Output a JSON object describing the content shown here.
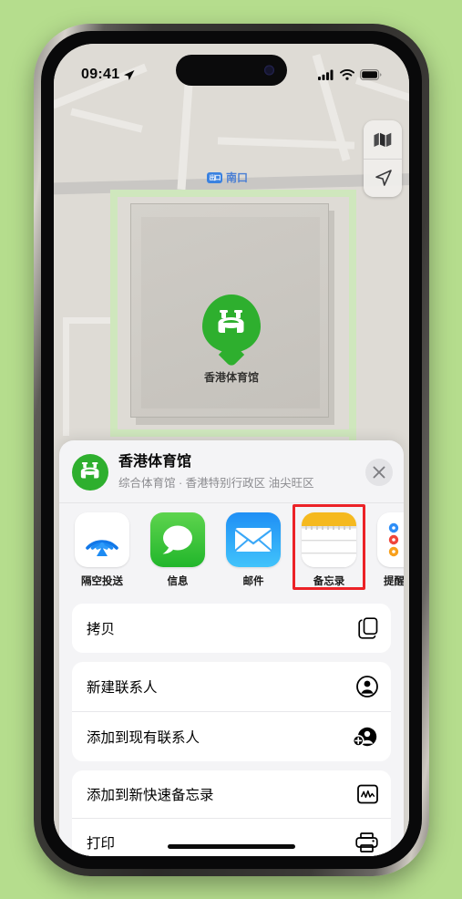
{
  "status_bar": {
    "time": "09:41",
    "location_arrow": "location-arrow",
    "cellular": "signal-bars",
    "wifi": "wifi",
    "battery": "battery-full"
  },
  "map": {
    "controls": [
      {
        "name": "map-layers",
        "icon": "map-icon"
      },
      {
        "name": "locate-me",
        "icon": "navigation-arrow-icon"
      }
    ],
    "labels": [
      {
        "badge": "出口",
        "text": "南口"
      }
    ],
    "pin": {
      "label": "香港体育馆",
      "icon": "stadium-icon",
      "color": "#2eaf2e"
    }
  },
  "share_sheet": {
    "title": "香港体育馆",
    "subtitle": "综合体育馆 · 香港特别行政区 油尖旺区",
    "avatar_icon": "stadium-icon",
    "close_label": "×",
    "apps": [
      {
        "label": "隔空投送",
        "icon": "airdrop-icon",
        "highlighted": false
      },
      {
        "label": "信息",
        "icon": "messages-icon",
        "highlighted": false
      },
      {
        "label": "邮件",
        "icon": "mail-icon",
        "highlighted": false
      },
      {
        "label": "备忘录",
        "icon": "notes-icon",
        "highlighted": true
      },
      {
        "label": "提醒事项",
        "icon": "reminders-icon",
        "highlighted": false
      }
    ],
    "actions": [
      {
        "label": "拷贝",
        "icon": "copy-icon"
      },
      {
        "label": "新建联系人",
        "icon": "person-circle-icon"
      },
      {
        "label": "添加到现有联系人",
        "icon": "person-add-icon"
      },
      {
        "label": "添加到新快速备忘录",
        "icon": "quick-note-icon"
      },
      {
        "label": "打印",
        "icon": "printer-icon"
      }
    ]
  },
  "colors": {
    "background": "#b5dd8d",
    "accent_green": "#2eaf2e",
    "highlight_red": "#ec2227",
    "sheet_bg": "#f4f4f6"
  }
}
